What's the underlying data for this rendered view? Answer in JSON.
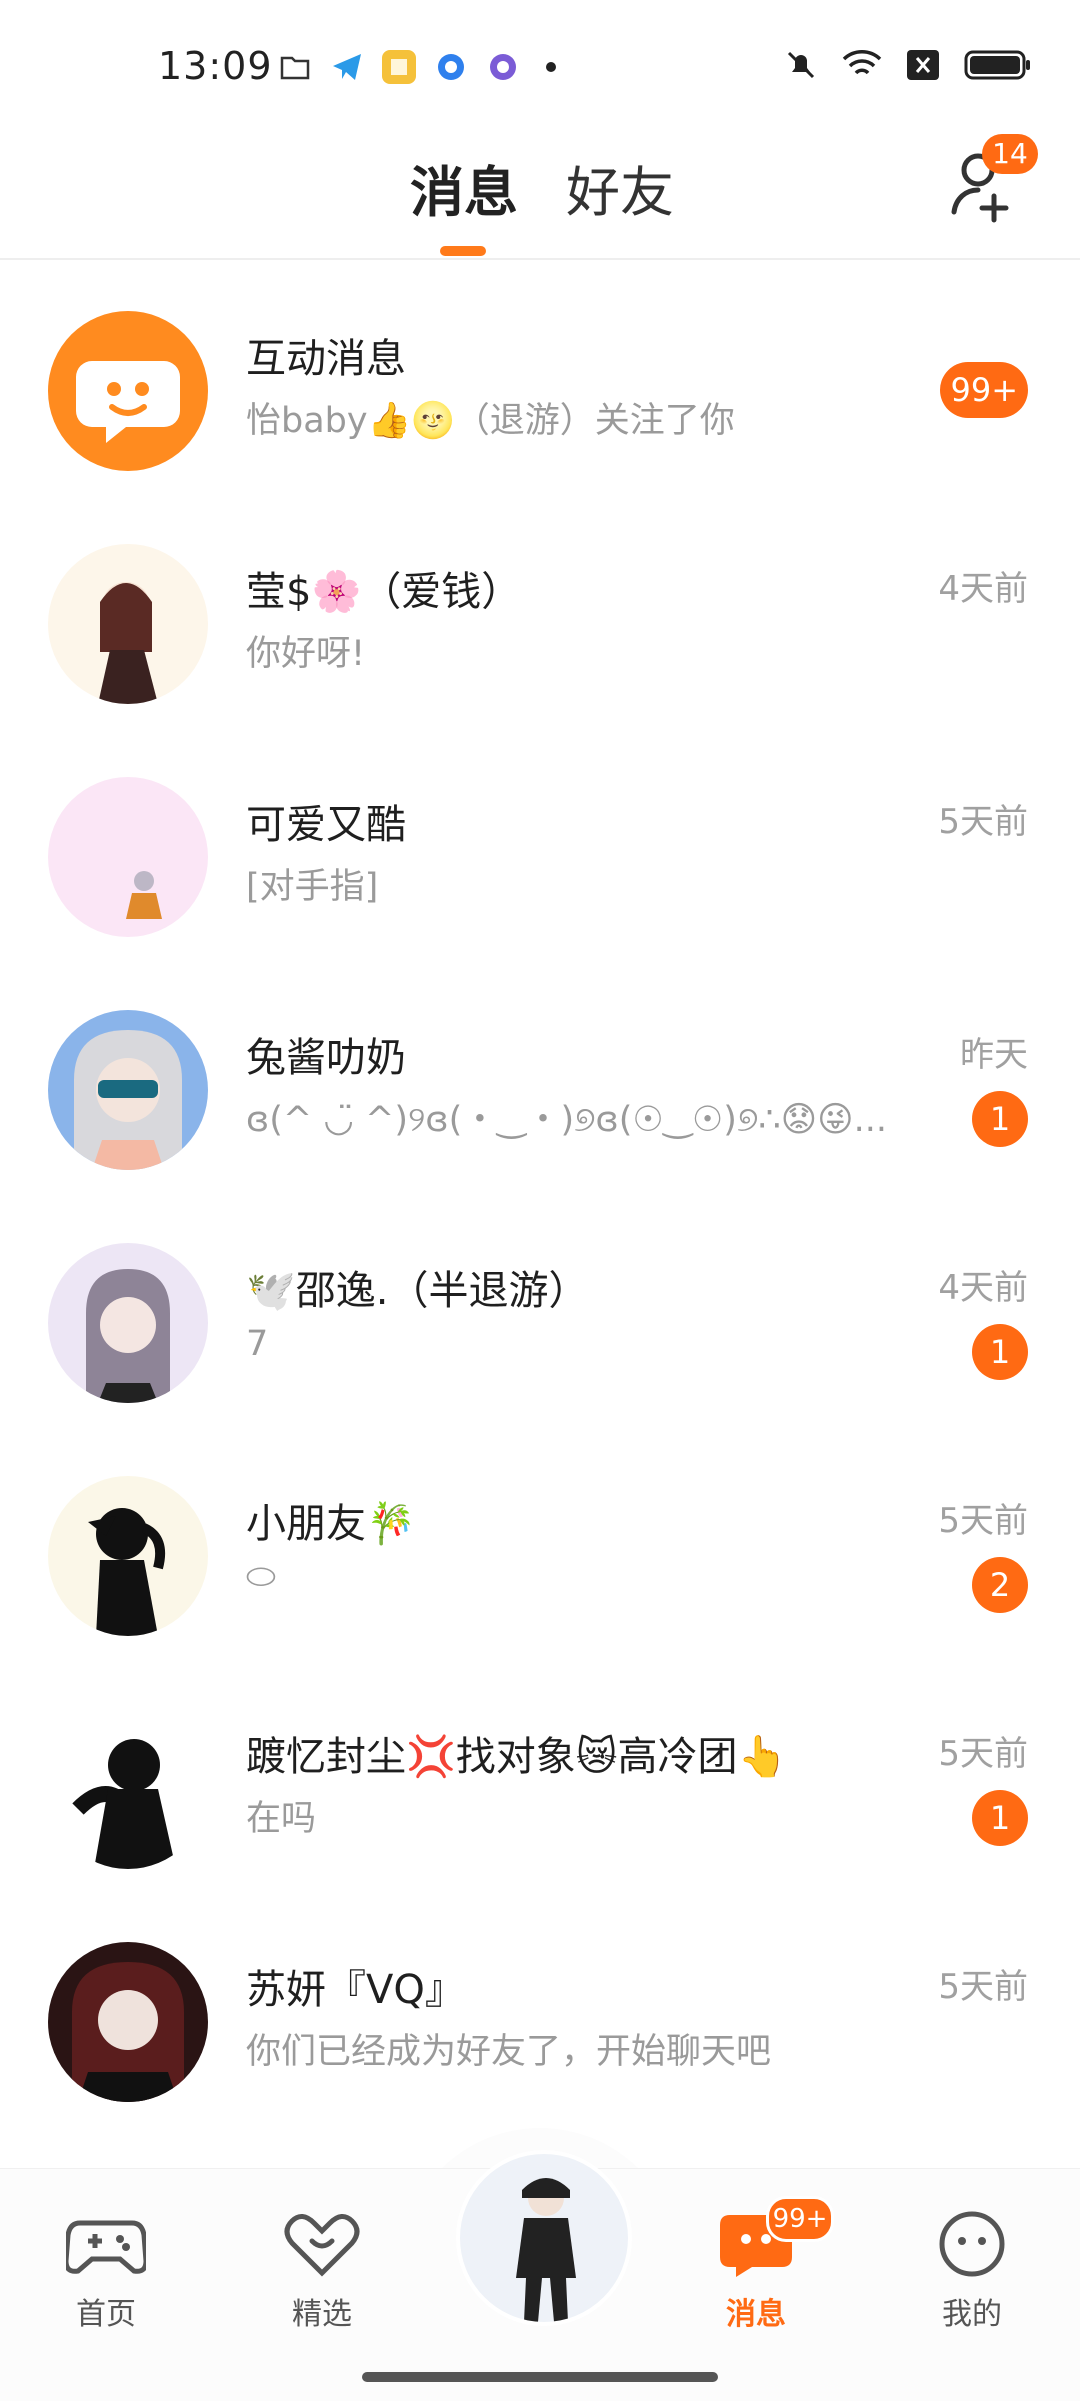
{
  "status": {
    "time": "13:09"
  },
  "header": {
    "tabs": [
      "消息",
      "好友"
    ],
    "add_friend_badge": "14"
  },
  "messages": [
    {
      "name": "互动消息",
      "preview": "怡baby👍🌝（退游）关注了你",
      "time": "",
      "count": "99+"
    },
    {
      "name": "莹$🌸（爱钱）",
      "preview": "你好呀!",
      "time": "4天前",
      "count": ""
    },
    {
      "name": "可爱又酷",
      "preview": "[对手指]",
      "time": "5天前",
      "count": ""
    },
    {
      "name": "兔酱叻奶",
      "preview": "ɞ(^ ◡̈ ^)୨ɞ(・‿・)୭ɞ(☉‿☉)୭∴😟😜...",
      "time": "昨天",
      "count": "1"
    },
    {
      "name": "🕊️邵逸.（半退游）",
      "preview": "7",
      "time": "4天前",
      "count": "1"
    },
    {
      "name": "小朋友🎋",
      "preview": "⬭",
      "time": "5天前",
      "count": "2"
    },
    {
      "name": "踱忆封尘💢找对象😿高冷团👆",
      "preview": "在吗",
      "time": "5天前",
      "count": "1"
    },
    {
      "name": "苏妍『VQ』",
      "preview": "你们已经成为好友了，开始聊天吧",
      "time": "5天前",
      "count": ""
    }
  ],
  "nav": {
    "home": "首页",
    "featured": "精选",
    "messages": "消息",
    "messages_badge": "99+",
    "mine": "我的"
  },
  "colors": {
    "accent": "#ff6a13",
    "text_secondary": "#9a9a9a"
  }
}
